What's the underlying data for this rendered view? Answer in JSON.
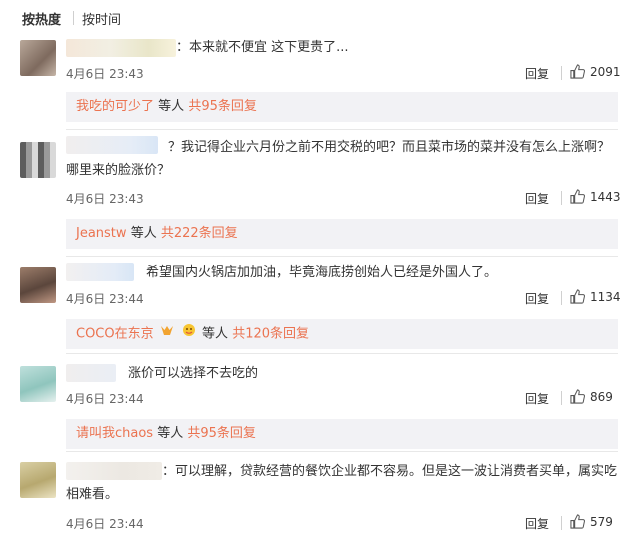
{
  "sort": {
    "hot_label": "按热度",
    "time_label": "按时间"
  },
  "comments": [
    {
      "text": "：本来就不便宜 这下更贵了...",
      "time": "4月6日 23:43",
      "reply_label": "回复",
      "likes": "2091",
      "reply_summary": {
        "user": "我吃的可少了",
        "others": "等人",
        "count": "共95条回复"
      }
    },
    {
      "text": "？我记得企业六月份之前不用交税的吧？而且菜市场的菜并没有怎么上涨啊？哪里来的脸涨价？",
      "time": "4月6日 23:43",
      "reply_label": "回复",
      "likes": "1443",
      "reply_summary": {
        "user": "Jeanstw",
        "others": "等人",
        "count": "共222条回复"
      }
    },
    {
      "text": "希望国内火锅店加加油，毕竟海底捞创始人已经是外国人了。",
      "time": "4月6日 23:44",
      "reply_label": "回复",
      "likes": "1134",
      "reply_summary": {
        "user": "COCO在东京",
        "others": "等人",
        "count": "共120条回复"
      }
    },
    {
      "text": "涨价可以选择不去吃的",
      "time": "4月6日 23:44",
      "reply_label": "回复",
      "likes": "869",
      "reply_summary": {
        "user": "请叫我chaos",
        "others": "等人",
        "count": "共95条回复"
      }
    },
    {
      "text": "：可以理解，贷款经营的餐饮企业都不容易。但是这一波让消费者买单，属实吃相难看。",
      "time": "4月6日 23:44",
      "reply_label": "回复",
      "likes": "579"
    }
  ],
  "colors": {
    "link": "#eb7350",
    "sub_bg": "#f2f2f5",
    "text": "#333333",
    "meta": "#666666"
  }
}
